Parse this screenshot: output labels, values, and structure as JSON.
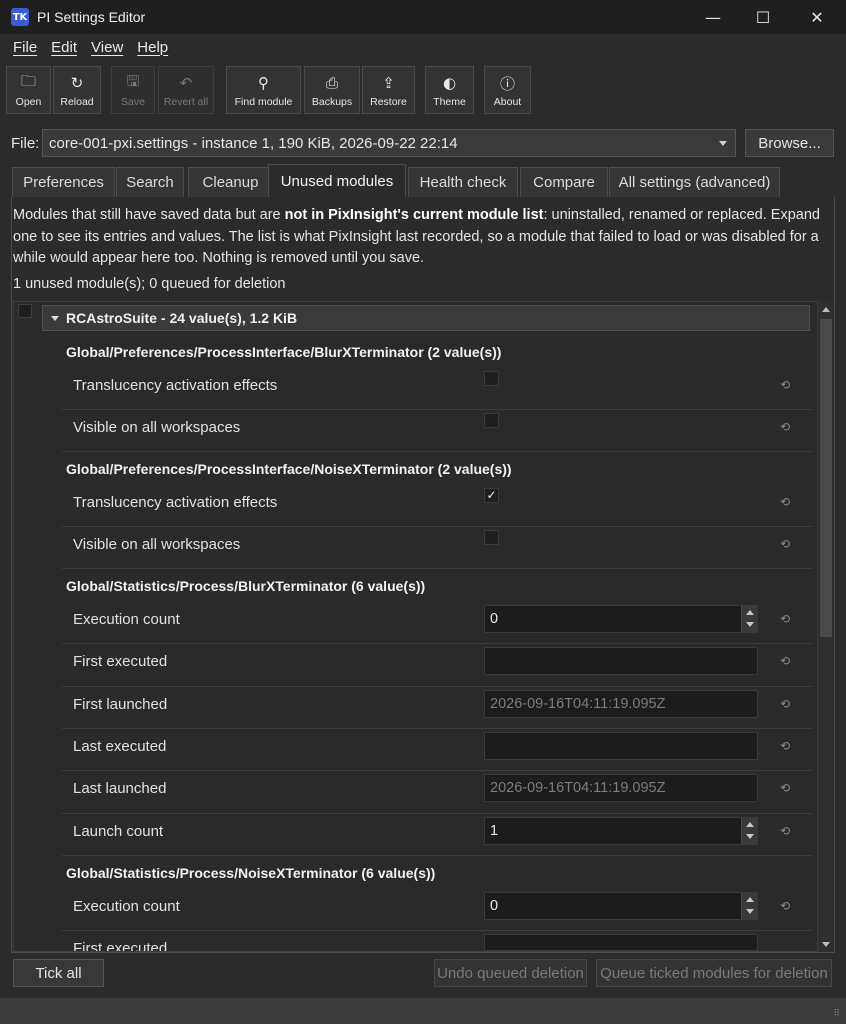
{
  "window": {
    "title": "PI Settings Editor",
    "icon_text": "TK",
    "minimize": "—",
    "maximize": "☐",
    "close": "✕"
  },
  "menu": [
    "File",
    "Edit",
    "View",
    "Help"
  ],
  "toolbar": [
    {
      "label": "Open",
      "icon": "folder-icon",
      "glyph": "🗀",
      "enabled": true
    },
    {
      "label": "Reload",
      "icon": "reload-icon",
      "glyph": "↻",
      "enabled": true
    },
    {
      "label": "Save",
      "icon": "save-icon",
      "glyph": "🖫",
      "enabled": false
    },
    {
      "label": "Revert all",
      "icon": "undo-icon",
      "glyph": "↶",
      "enabled": false
    },
    {
      "label": "Find module",
      "icon": "search-icon",
      "glyph": "⚲",
      "enabled": true
    },
    {
      "label": "Backups",
      "icon": "printer-icon",
      "glyph": "⎙",
      "enabled": true
    },
    {
      "label": "Restore",
      "icon": "upload-icon",
      "glyph": "⇪",
      "enabled": true
    },
    {
      "label": "Theme",
      "icon": "theme-icon",
      "glyph": "◐",
      "enabled": true
    },
    {
      "label": "About",
      "icon": "info-icon",
      "glyph": "ⓘ",
      "enabled": true
    }
  ],
  "file": {
    "label": "File:",
    "selected": "core-001-pxi.settings - instance 1, 190 KiB, 2026-09-22 22:14",
    "browse": "Browse..."
  },
  "tabs": [
    "Preferences",
    "Search",
    "Cleanup",
    "Unused modules",
    "Health check",
    "Compare",
    "All settings (advanced)"
  ],
  "active_tab": "Unused modules",
  "description": {
    "part1": "Modules that still have saved data but are ",
    "bold": "not in PixInsight's current module list",
    "part2": ": uninstalled, renamed or replaced. Expand one to see its entries and values. The list is what PixInsight last recorded, so a module that failed to load or was disabled for a while would appear here too. Nothing is removed until you save."
  },
  "summary": "1 unused module(s); 0 queued for deletion",
  "module": {
    "name": "RCAstroSuite  -  24 value(s), 1.2 KiB",
    "checked": false
  },
  "groups": [
    {
      "title": "Global/Preferences/ProcessInterface/BlurXTerminator  (2 value(s))",
      "rows": [
        {
          "label": "Translucency activation effects",
          "kind": "check",
          "checked": false
        },
        {
          "label": "Visible on all workspaces",
          "kind": "check",
          "checked": false
        }
      ]
    },
    {
      "title": "Global/Preferences/ProcessInterface/NoiseXTerminator  (2 value(s))",
      "rows": [
        {
          "label": "Translucency activation effects",
          "kind": "check",
          "checked": true
        },
        {
          "label": "Visible on all workspaces",
          "kind": "check",
          "checked": false
        }
      ]
    },
    {
      "title": "Global/Statistics/Process/BlurXTerminator  (6 value(s))",
      "rows": [
        {
          "label": "Execution count",
          "kind": "spin",
          "value": "0"
        },
        {
          "label": "First executed",
          "kind": "text",
          "value": ""
        },
        {
          "label": "First launched",
          "kind": "readonly",
          "value": "2026-09-16T04:11:19.095Z"
        },
        {
          "label": "Last executed",
          "kind": "text",
          "value": ""
        },
        {
          "label": "Last launched",
          "kind": "readonly",
          "value": "2026-09-16T04:11:19.095Z"
        },
        {
          "label": "Launch count",
          "kind": "spin",
          "value": "1"
        }
      ]
    },
    {
      "title": "Global/Statistics/Process/NoiseXTerminator  (6 value(s))",
      "rows": [
        {
          "label": "Execution count",
          "kind": "spin",
          "value": "0"
        },
        {
          "label": "First executed",
          "kind": "text",
          "value": ""
        }
      ]
    }
  ],
  "reset_glyph": "⟲",
  "checkmark": "✓",
  "buttons": {
    "tick_all": "Tick all",
    "undo": "Undo queued deletion",
    "queue": "Queue ticked modules for deletion"
  },
  "grip": "⠿"
}
